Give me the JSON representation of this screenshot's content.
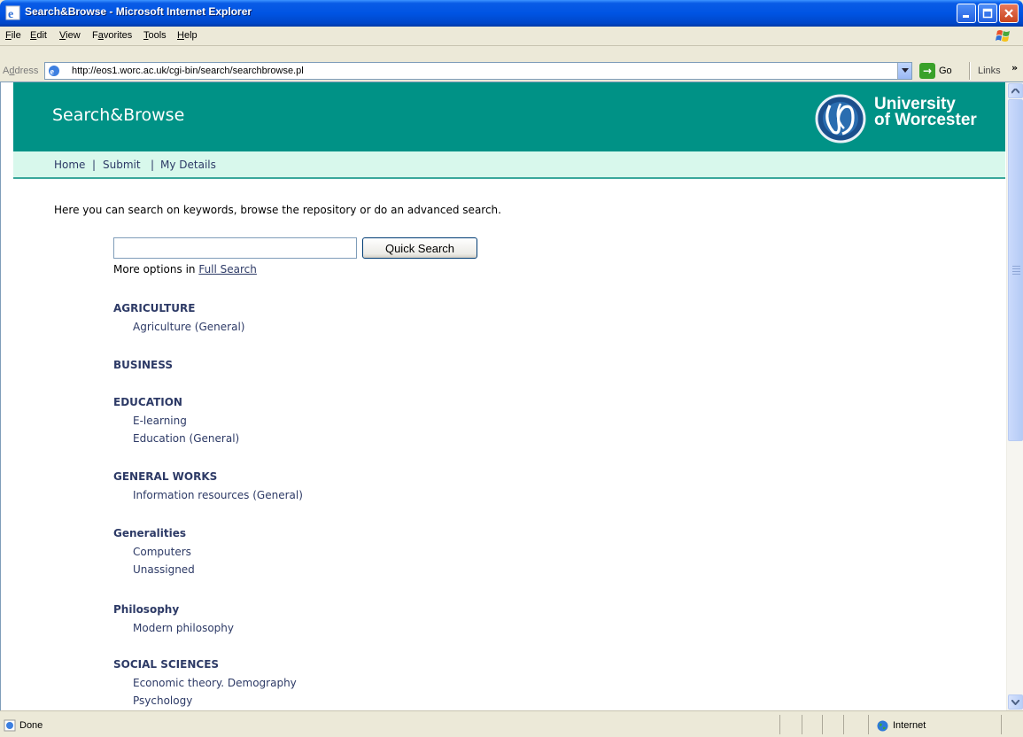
{
  "window": {
    "title": "Search&Browse - Microsoft Internet Explorer"
  },
  "menu": {
    "items": [
      {
        "accel": "F",
        "rest": "ile"
      },
      {
        "accel": "E",
        "rest": "dit"
      },
      {
        "accel": "V",
        "rest": "iew"
      },
      {
        "pre": "F",
        "accel": "a",
        "rest": "vorites"
      },
      {
        "accel": "T",
        "rest": "ools"
      },
      {
        "accel": "H",
        "rest": "elp"
      }
    ]
  },
  "address": {
    "label_pre": "A",
    "label_accel": "d",
    "label_rest": "dress",
    "url": "http://eos1.worc.ac.uk/cgi-bin/search/searchbrowse.pl",
    "go_label": "Go",
    "links_label": "Links",
    "links_more": "»"
  },
  "site": {
    "title": "Search&Browse",
    "logo_line1": "University",
    "logo_line2": "of Worcester",
    "nav": [
      "Home",
      "Submit",
      "My Details"
    ],
    "nav_sep": "|"
  },
  "main": {
    "intro": "Here you can search on keywords, browse the repository or do an advanced search.",
    "search_value": "",
    "search_button": "Quick Search",
    "more_options_prefix": "More options in ",
    "full_search_link": "Full Search",
    "subjects": [
      {
        "heading": "AGRICULTURE",
        "items": [
          "Agriculture (General)"
        ]
      },
      {
        "heading": "BUSINESS",
        "items": []
      },
      {
        "heading": "EDUCATION",
        "items": [
          "E-learning",
          "Education (General)"
        ]
      },
      {
        "heading": "GENERAL WORKS",
        "items": [
          "Information resources (General)"
        ]
      },
      {
        "heading": "Generalities",
        "items": [
          "Computers",
          "Unassigned"
        ]
      },
      {
        "heading": "Philosophy",
        "items": [
          "Modern philosophy"
        ]
      },
      {
        "heading": "SOCIAL SCIENCES",
        "items": [
          "Economic theory. Demography",
          "Psychology"
        ]
      }
    ]
  },
  "status": {
    "text": "Done",
    "zone": "Internet"
  }
}
